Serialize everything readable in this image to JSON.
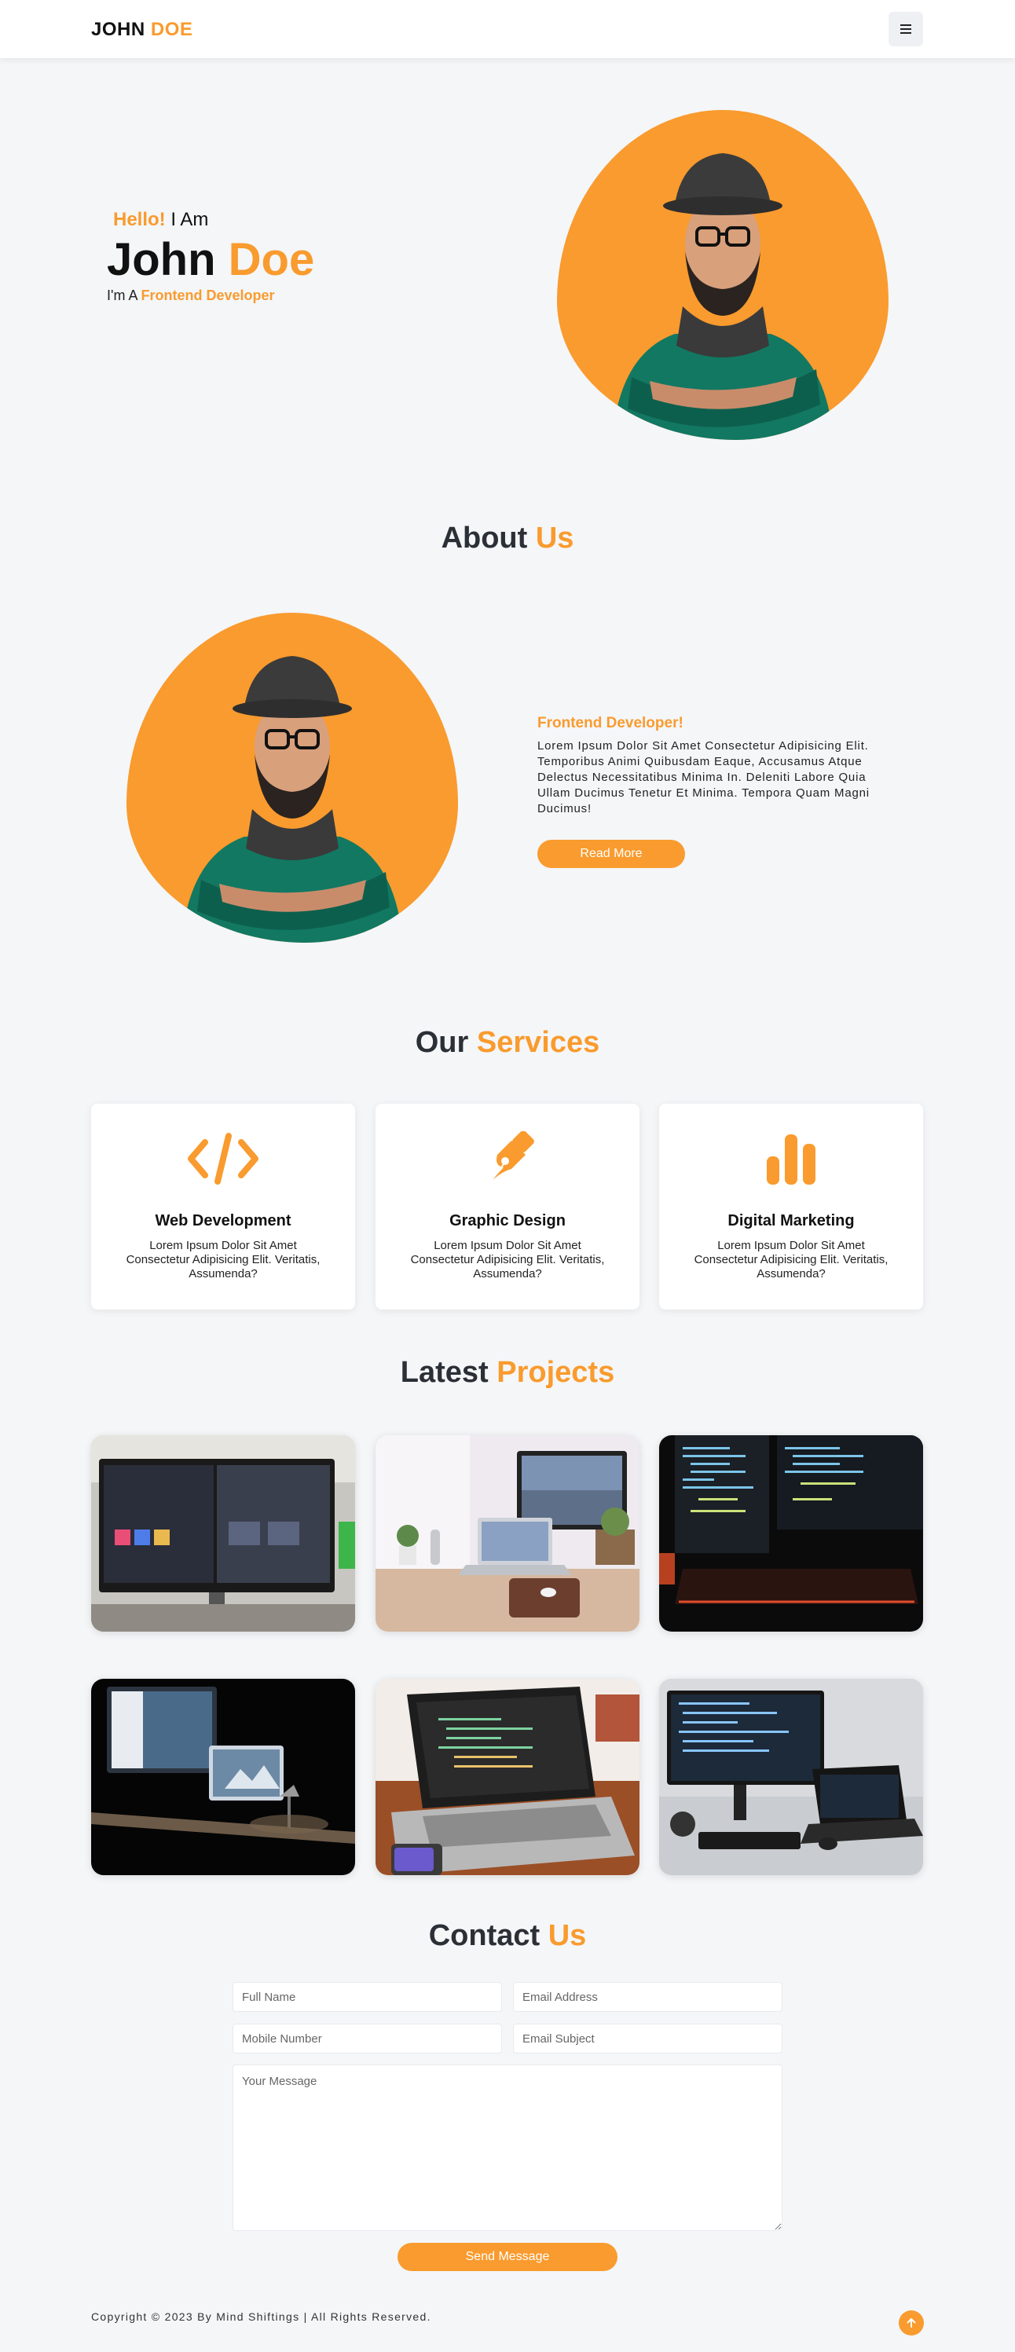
{
  "nav": {
    "logo_first": "JOHN",
    "logo_second": "DOE"
  },
  "hero": {
    "hello": "Hello!",
    "i_am": "I Am",
    "first_name": "John",
    "last_name": "Doe",
    "role_prefix": "I'm A",
    "role": "Frontend Developer"
  },
  "about": {
    "title_a": "About",
    "title_b": "Us",
    "role": "Frontend Developer!",
    "description": "Lorem Ipsum Dolor Sit Amet Consectetur Adipisicing Elit. Temporibus Animi Quibusdam Eaque, Accusamus Atque Delectus Necessitatibus Minima In. Deleniti Labore Quia Ullam Ducimus Tenetur Et Minima. Tempora Quam Magni Ducimus!",
    "button": "Read More"
  },
  "services": {
    "title_a": "Our",
    "title_b": "Services",
    "items": [
      {
        "icon": "code-icon",
        "title": "Web Development",
        "desc": "Lorem Ipsum Dolor Sit Amet Consectetur Adipisicing Elit. Veritatis, Assumenda?"
      },
      {
        "icon": "pen-nib-icon",
        "title": "Graphic Design",
        "desc": "Lorem Ipsum Dolor Sit Amet Consectetur Adipisicing Elit. Veritatis, Assumenda?"
      },
      {
        "icon": "bar-chart-icon",
        "title": "Digital Marketing",
        "desc": "Lorem Ipsum Dolor Sit Amet Consectetur Adipisicing Elit. Veritatis, Assumenda?"
      }
    ]
  },
  "projects": {
    "title_a": "Latest",
    "title_b": "Projects"
  },
  "contact": {
    "title_a": "Contact",
    "title_b": "Us",
    "full_name_placeholder": "Full Name",
    "email_placeholder": "Email Address",
    "mobile_placeholder": "Mobile Number",
    "subject_placeholder": "Email Subject",
    "message_placeholder": "Your Message",
    "send_button": "Send Message"
  },
  "footer": {
    "copyright": "Copyright © 2023 By Mind Shiftings | All Rights Reserved."
  },
  "colors": {
    "accent": "#f99b2e",
    "background": "#f4f6f8",
    "text": "#2b2f36"
  }
}
